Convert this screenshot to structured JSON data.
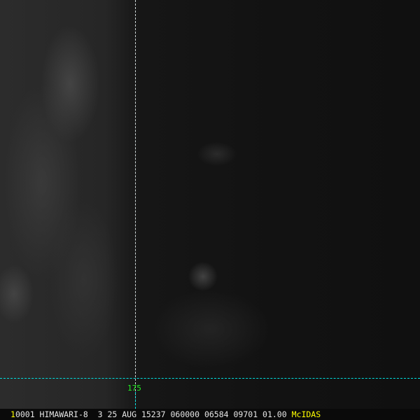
{
  "overlay": {
    "longitude_label": "175"
  },
  "status_bar": {
    "frame_number": "1",
    "text": "0001 HIMAWARI-8  3 25 AUG 15237 060000 06584 09701 01.00",
    "brand": "McIDAS"
  },
  "colors": {
    "grid_line": "#00dede",
    "label": "#22ee22",
    "brand": "#ffff00"
  }
}
